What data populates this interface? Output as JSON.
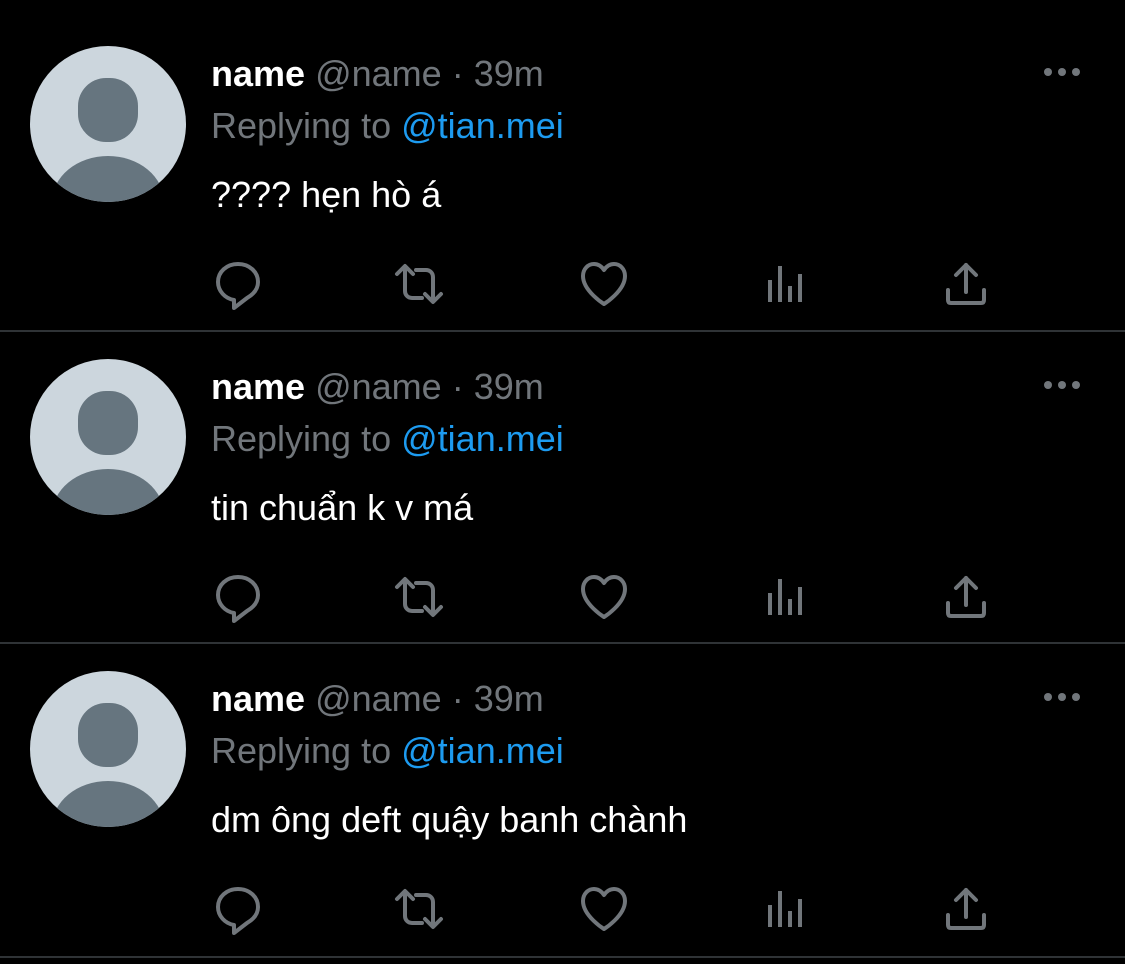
{
  "icons": {
    "avatar": "default-avatar-icon",
    "more": "more-options-icon",
    "reply": "reply-icon",
    "retweet": "retweet-icon",
    "like": "like-icon",
    "views": "views-icon",
    "share": "share-icon"
  },
  "colors": {
    "background": "#000000",
    "name": "#ffffff",
    "muted": "#71767b",
    "mention": "#1d9bf0",
    "divider": "#2f3336"
  },
  "tweets": [
    {
      "name": "name",
      "handle": "@name",
      "separator": "·",
      "time": "39m",
      "replying_to_label": "Replying to",
      "replying_to_handle": "@tian.mei",
      "text": "???? hẹn hò á"
    },
    {
      "name": "name",
      "handle": "@name",
      "separator": "·",
      "time": "39m",
      "replying_to_label": "Replying to",
      "replying_to_handle": "@tian.mei",
      "text": "tin chuẩn k v má"
    },
    {
      "name": "name",
      "handle": "@name",
      "separator": "·",
      "time": "39m",
      "replying_to_label": "Replying to",
      "replying_to_handle": "@tian.mei",
      "text": "dm ông deft quậy banh chành"
    }
  ]
}
